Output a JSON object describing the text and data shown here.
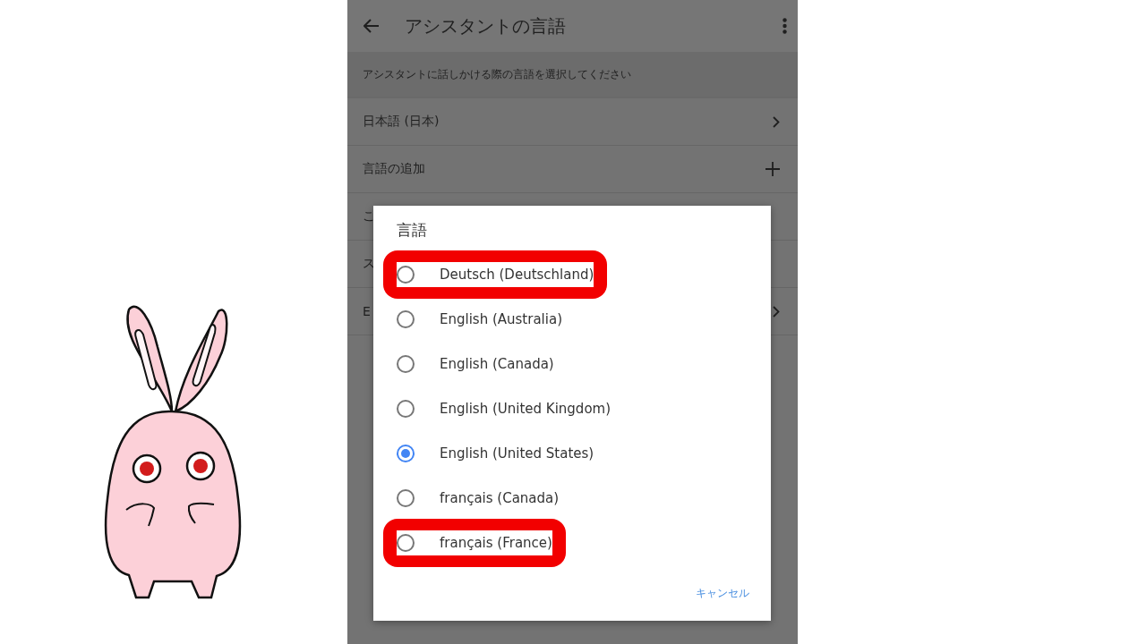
{
  "app_bar": {
    "title": "アシスタントの言語"
  },
  "description": "アシスタントに話しかける際の言語を選択してください",
  "rows": [
    {
      "label": "日本語 (日本)",
      "kind": "chevron"
    },
    {
      "label": "言語の追加",
      "kind": "add"
    },
    {
      "label": "こ",
      "kind": "plain"
    },
    {
      "label": "ス",
      "kind": "plain"
    },
    {
      "label": "E",
      "kind": "chevron"
    }
  ],
  "dialog": {
    "title": "言語",
    "options": [
      {
        "label": "Deutsch (Deutschland)",
        "selected": false,
        "highlighted": true
      },
      {
        "label": "English (Australia)",
        "selected": false,
        "highlighted": false
      },
      {
        "label": "English (Canada)",
        "selected": false,
        "highlighted": false
      },
      {
        "label": "English (United Kingdom)",
        "selected": false,
        "highlighted": false
      },
      {
        "label": "English (United States)",
        "selected": true,
        "highlighted": false
      },
      {
        "label": "français (Canada)",
        "selected": false,
        "highlighted": false
      },
      {
        "label": "français (France)",
        "selected": false,
        "highlighted": true
      }
    ],
    "cancel": "キャンセル"
  }
}
